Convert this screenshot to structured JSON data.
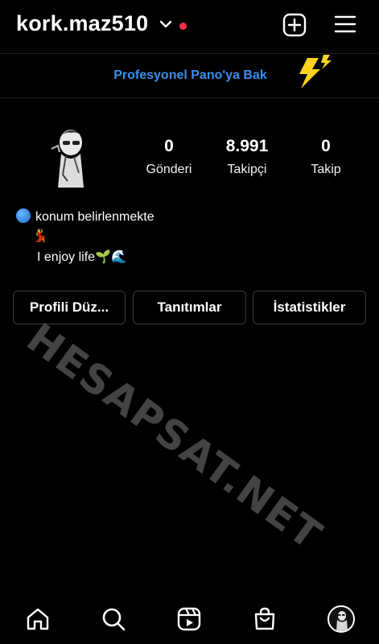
{
  "header": {
    "username": "kork.maz510",
    "icons": {
      "chevron": "chevron-down-icon",
      "notification_dot": "red-dot",
      "create": "plus-square-icon",
      "menu": "hamburger-menu-icon"
    }
  },
  "banner": {
    "label": "Profesyonel Pano'ya Bak",
    "icon": "lightning-bolt-icon",
    "color": "#3a8fe9"
  },
  "stats": [
    {
      "value": "0",
      "label": "Gönderi"
    },
    {
      "value": "8.991",
      "label": "Takipçi"
    },
    {
      "value": "0",
      "label": "Takip"
    }
  ],
  "bio": {
    "location_emoji": "🌐",
    "location": "konum belirlenmekte",
    "dancer_emoji": "💃",
    "tagline": "I enjoy life🌱🌊"
  },
  "buttons": {
    "edit_profile": "Profili Düz...",
    "promotions": "Tanıtımlar",
    "insights": "İstatistikler"
  },
  "watermark": "HESAPSAT.NET",
  "tabbar": {
    "items": [
      "home-icon",
      "search-icon",
      "reels-icon",
      "shop-icon",
      "profile-avatar"
    ]
  },
  "colors": {
    "background": "#000000",
    "accent": "#3a8fe9",
    "dot": "#ff3040"
  }
}
